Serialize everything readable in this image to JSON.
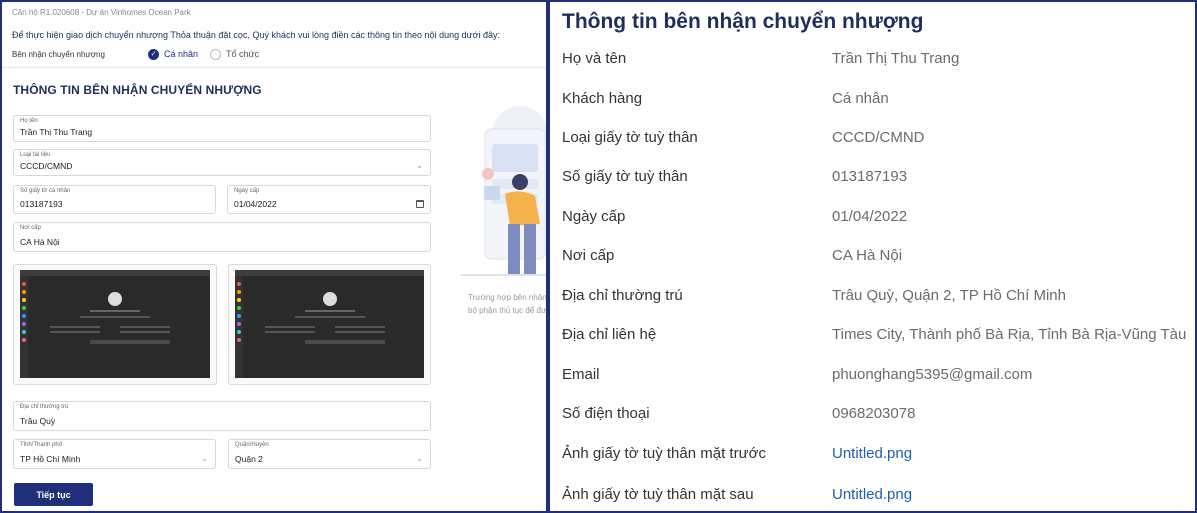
{
  "left": {
    "breadcrumb": "Căn hộ R1.020608 - Dự án Vinhomes Ocean Park",
    "intro": "Để thực hiện giao dịch chuyển nhượng Thỏa thuận đặt cọc, Quý khách vui lòng điền các thông tin theo nội dung dưới đây:",
    "recipient_type_label": "Bên nhận chuyển nhượng",
    "recipient_options": [
      "Cá nhân",
      "Tổ chức"
    ],
    "recipient_selected": "Cá nhân",
    "form_title": "THÔNG TIN BÊN NHẬN CHUYỂN NHƯỢNG",
    "fields": {
      "full_name": {
        "label": "Họ tên",
        "value": "Trần Thị Thu Trang"
      },
      "doc_type": {
        "label": "Loại tài liệu",
        "value": "CCCD/CMND"
      },
      "id_number": {
        "label": "Số giấy tờ cá nhân",
        "value": "013187193"
      },
      "issue_date": {
        "label": "Ngày cấp",
        "value": "01/04/2022"
      },
      "issue_place": {
        "label": "Nơi cấp",
        "value": "CA Hà Nội"
      },
      "permanent_address": {
        "label": "Địa chỉ thường trú",
        "value": "Trâu Quỳ"
      },
      "province": {
        "label": "Tỉnh/Thành phố",
        "value": "TP Hồ Chí Minh"
      },
      "district": {
        "label": "Quận/Huyện",
        "value": "Quận 2"
      }
    },
    "hint_line1": "Trường hợp bên nhận",
    "hint_line2": "bộ phận thủ tục để đư",
    "continue_button": "Tiếp tục"
  },
  "right": {
    "title": "Thông tin bên nhận chuyển nhượng",
    "rows": [
      {
        "label": "Họ và tên",
        "value": "Trần Thị Thu Trang"
      },
      {
        "label": "Khách hàng",
        "value": "Cá nhân"
      },
      {
        "label": "Loại giấy tờ tuỳ thân",
        "value": "CCCD/CMND"
      },
      {
        "label": "Số giấy tờ tuỳ thân",
        "value": "013187193"
      },
      {
        "label": "Ngày cấp",
        "value": "01/04/2022"
      },
      {
        "label": "Nơi cấp",
        "value": "CA Hà Nội"
      },
      {
        "label": "Địa chỉ thường trú",
        "value": "Trâu Quỳ, Quận 2, TP Hồ Chí Minh"
      },
      {
        "label": "Địa chỉ liên hệ",
        "value": "Times City, Thành phố Bà Rịa, Tỉnh Bà Rịa-Vũng Tàu"
      },
      {
        "label": "Email",
        "value": "phuonghang5395@gmail.com"
      },
      {
        "label": "Số điện thoại",
        "value": "0968203078"
      },
      {
        "label": "Ảnh giấy tờ tuỳ thân mặt trước",
        "value": "Untitled.png"
      },
      {
        "label": "Ảnh giấy tờ tuỳ thân mặt sau",
        "value": "Untitled.png"
      }
    ]
  },
  "colors": {
    "brand": "#1f2f7a",
    "link": "#1a5fb4",
    "value_gray": "#6b6b6b"
  },
  "icons": [
    "check-circle-icon",
    "radio-empty-icon",
    "chevron-down-icon",
    "calendar-icon"
  ]
}
